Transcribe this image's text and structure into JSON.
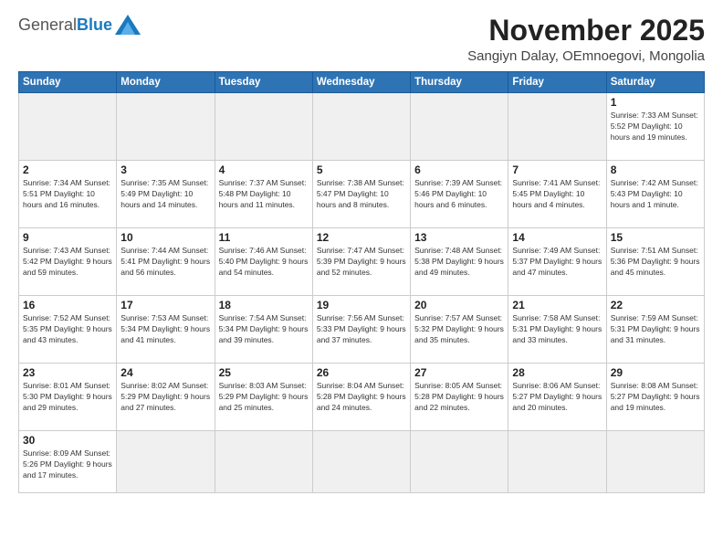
{
  "header": {
    "logo_general": "General",
    "logo_blue": "Blue",
    "month": "November 2025",
    "location": "Sangiyn Dalay, OEmnoegovi, Mongolia"
  },
  "days_of_week": [
    "Sunday",
    "Monday",
    "Tuesday",
    "Wednesday",
    "Thursday",
    "Friday",
    "Saturday"
  ],
  "weeks": [
    [
      {
        "day": "",
        "info": ""
      },
      {
        "day": "",
        "info": ""
      },
      {
        "day": "",
        "info": ""
      },
      {
        "day": "",
        "info": ""
      },
      {
        "day": "",
        "info": ""
      },
      {
        "day": "",
        "info": ""
      },
      {
        "day": "1",
        "info": "Sunrise: 7:33 AM\nSunset: 5:52 PM\nDaylight: 10 hours\nand 19 minutes."
      }
    ],
    [
      {
        "day": "2",
        "info": "Sunrise: 7:34 AM\nSunset: 5:51 PM\nDaylight: 10 hours\nand 16 minutes."
      },
      {
        "day": "3",
        "info": "Sunrise: 7:35 AM\nSunset: 5:49 PM\nDaylight: 10 hours\nand 14 minutes."
      },
      {
        "day": "4",
        "info": "Sunrise: 7:37 AM\nSunset: 5:48 PM\nDaylight: 10 hours\nand 11 minutes."
      },
      {
        "day": "5",
        "info": "Sunrise: 7:38 AM\nSunset: 5:47 PM\nDaylight: 10 hours\nand 8 minutes."
      },
      {
        "day": "6",
        "info": "Sunrise: 7:39 AM\nSunset: 5:46 PM\nDaylight: 10 hours\nand 6 minutes."
      },
      {
        "day": "7",
        "info": "Sunrise: 7:41 AM\nSunset: 5:45 PM\nDaylight: 10 hours\nand 4 minutes."
      },
      {
        "day": "8",
        "info": "Sunrise: 7:42 AM\nSunset: 5:43 PM\nDaylight: 10 hours\nand 1 minute."
      }
    ],
    [
      {
        "day": "9",
        "info": "Sunrise: 7:43 AM\nSunset: 5:42 PM\nDaylight: 9 hours\nand 59 minutes."
      },
      {
        "day": "10",
        "info": "Sunrise: 7:44 AM\nSunset: 5:41 PM\nDaylight: 9 hours\nand 56 minutes."
      },
      {
        "day": "11",
        "info": "Sunrise: 7:46 AM\nSunset: 5:40 PM\nDaylight: 9 hours\nand 54 minutes."
      },
      {
        "day": "12",
        "info": "Sunrise: 7:47 AM\nSunset: 5:39 PM\nDaylight: 9 hours\nand 52 minutes."
      },
      {
        "day": "13",
        "info": "Sunrise: 7:48 AM\nSunset: 5:38 PM\nDaylight: 9 hours\nand 49 minutes."
      },
      {
        "day": "14",
        "info": "Sunrise: 7:49 AM\nSunset: 5:37 PM\nDaylight: 9 hours\nand 47 minutes."
      },
      {
        "day": "15",
        "info": "Sunrise: 7:51 AM\nSunset: 5:36 PM\nDaylight: 9 hours\nand 45 minutes."
      }
    ],
    [
      {
        "day": "16",
        "info": "Sunrise: 7:52 AM\nSunset: 5:35 PM\nDaylight: 9 hours\nand 43 minutes."
      },
      {
        "day": "17",
        "info": "Sunrise: 7:53 AM\nSunset: 5:34 PM\nDaylight: 9 hours\nand 41 minutes."
      },
      {
        "day": "18",
        "info": "Sunrise: 7:54 AM\nSunset: 5:34 PM\nDaylight: 9 hours\nand 39 minutes."
      },
      {
        "day": "19",
        "info": "Sunrise: 7:56 AM\nSunset: 5:33 PM\nDaylight: 9 hours\nand 37 minutes."
      },
      {
        "day": "20",
        "info": "Sunrise: 7:57 AM\nSunset: 5:32 PM\nDaylight: 9 hours\nand 35 minutes."
      },
      {
        "day": "21",
        "info": "Sunrise: 7:58 AM\nSunset: 5:31 PM\nDaylight: 9 hours\nand 33 minutes."
      },
      {
        "day": "22",
        "info": "Sunrise: 7:59 AM\nSunset: 5:31 PM\nDaylight: 9 hours\nand 31 minutes."
      }
    ],
    [
      {
        "day": "23",
        "info": "Sunrise: 8:01 AM\nSunset: 5:30 PM\nDaylight: 9 hours\nand 29 minutes."
      },
      {
        "day": "24",
        "info": "Sunrise: 8:02 AM\nSunset: 5:29 PM\nDaylight: 9 hours\nand 27 minutes."
      },
      {
        "day": "25",
        "info": "Sunrise: 8:03 AM\nSunset: 5:29 PM\nDaylight: 9 hours\nand 25 minutes."
      },
      {
        "day": "26",
        "info": "Sunrise: 8:04 AM\nSunset: 5:28 PM\nDaylight: 9 hours\nand 24 minutes."
      },
      {
        "day": "27",
        "info": "Sunrise: 8:05 AM\nSunset: 5:28 PM\nDaylight: 9 hours\nand 22 minutes."
      },
      {
        "day": "28",
        "info": "Sunrise: 8:06 AM\nSunset: 5:27 PM\nDaylight: 9 hours\nand 20 minutes."
      },
      {
        "day": "29",
        "info": "Sunrise: 8:08 AM\nSunset: 5:27 PM\nDaylight: 9 hours\nand 19 minutes."
      }
    ],
    [
      {
        "day": "30",
        "info": "Sunrise: 8:09 AM\nSunset: 5:26 PM\nDaylight: 9 hours\nand 17 minutes."
      },
      {
        "day": "",
        "info": ""
      },
      {
        "day": "",
        "info": ""
      },
      {
        "day": "",
        "info": ""
      },
      {
        "day": "",
        "info": ""
      },
      {
        "day": "",
        "info": ""
      },
      {
        "day": "",
        "info": ""
      }
    ]
  ]
}
